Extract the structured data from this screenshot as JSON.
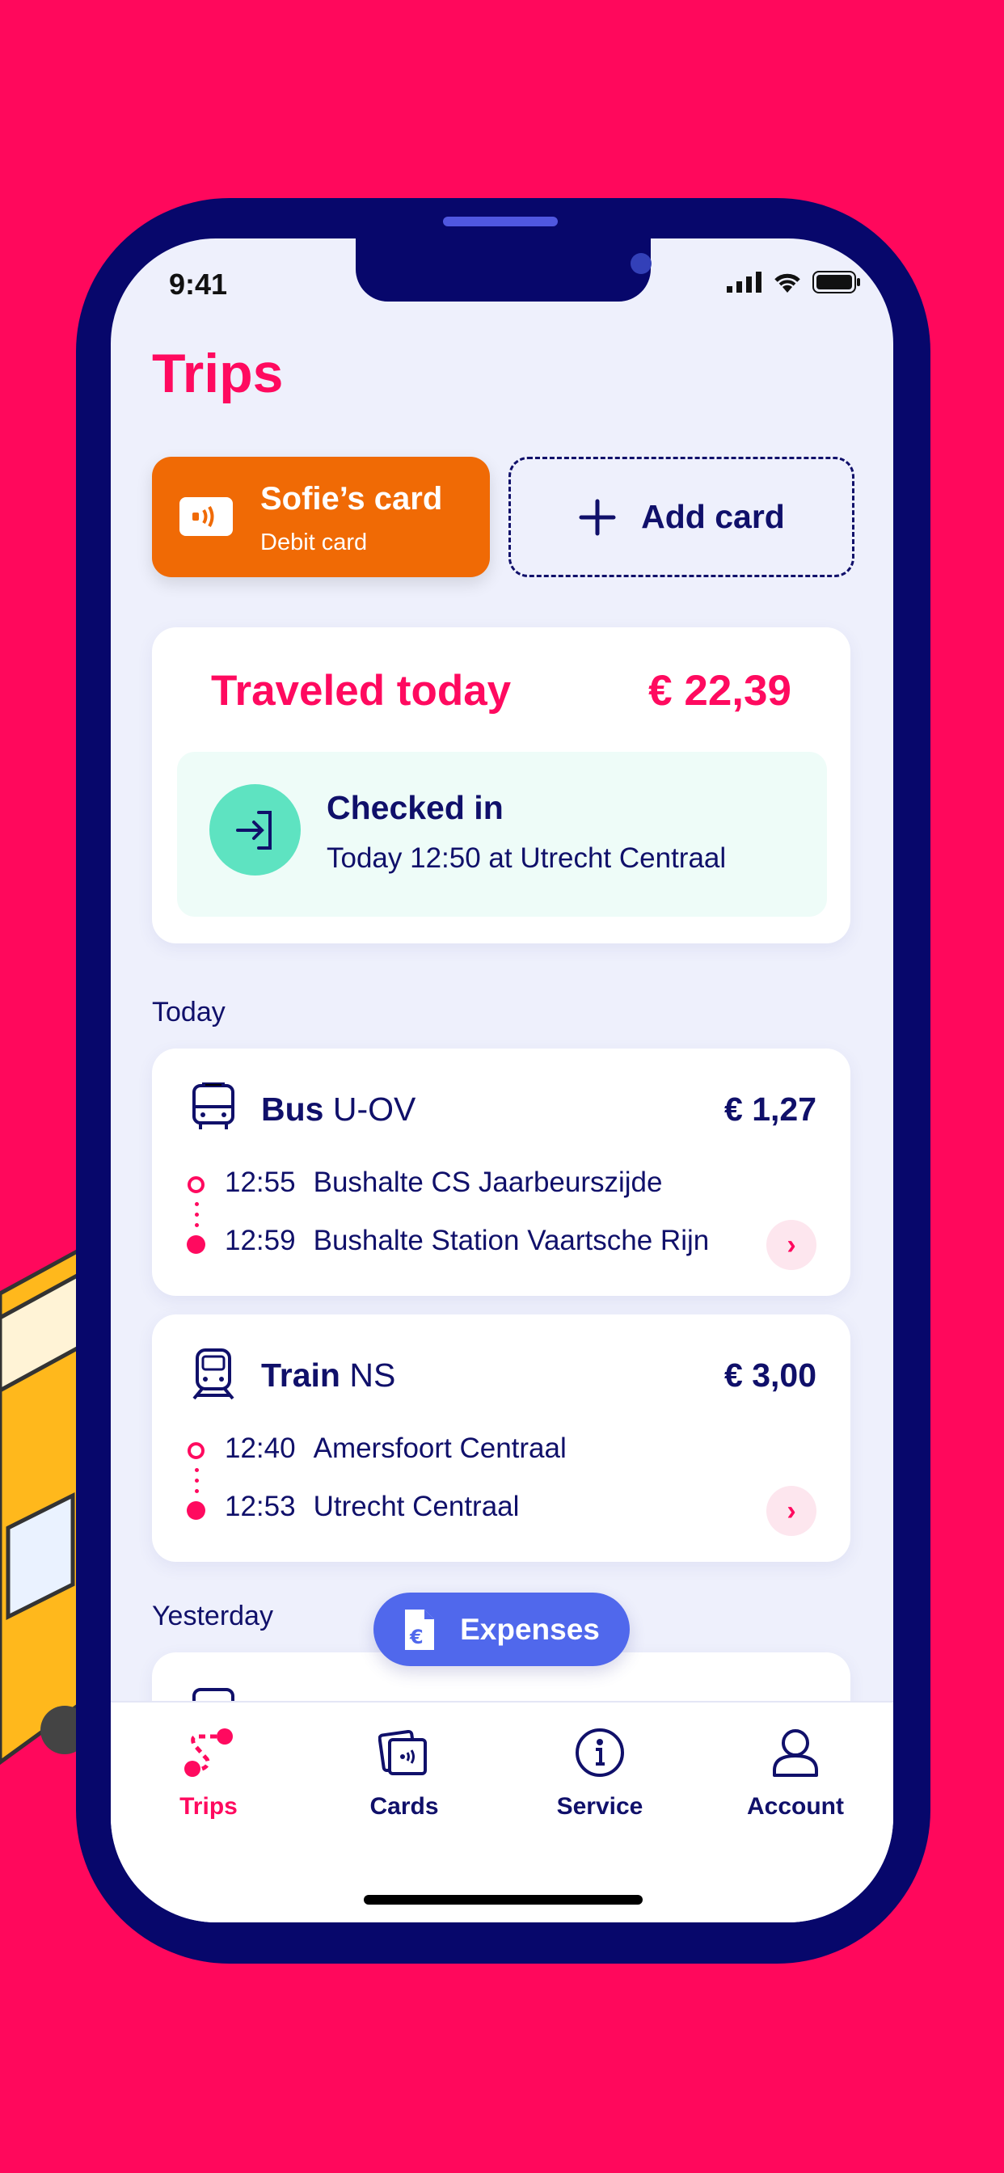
{
  "status_bar": {
    "time": "9:41"
  },
  "header": {
    "title": "Trips"
  },
  "cards": {
    "selected": {
      "name": "Sofie’s card",
      "type": "Debit card",
      "color": "#f06a05"
    },
    "add_label": "Add card"
  },
  "summary": {
    "label": "Traveled today",
    "amount": "€ 22,39",
    "checkin": {
      "title": "Checked in",
      "detail": "Today 12:50 at Utrecht Centraal"
    }
  },
  "sections": {
    "today": "Today",
    "yesterday": "Yesterday"
  },
  "trips": [
    {
      "mode": "Bus",
      "operator": "U-OV",
      "price": "€ 1,27",
      "icon": "bus-icon",
      "from_time": "12:55",
      "from": "Bushalte CS Jaarbeurszijde",
      "to_time": "12:59",
      "to": "Bushalte Station Vaartsche Rijn"
    },
    {
      "mode": "Train",
      "operator": "NS",
      "price": "€ 3,00",
      "icon": "train-icon",
      "from_time": "12:40",
      "from": "Amersfoort Centraal",
      "to_time": "12:53",
      "to": "Utrecht Centraal"
    }
  ],
  "expenses_label": "Expenses",
  "tabs": [
    {
      "label": "Trips",
      "active": true
    },
    {
      "label": "Cards"
    },
    {
      "label": "Service"
    },
    {
      "label": "Account"
    }
  ],
  "colors": {
    "background": "#ff085c",
    "accent": "#ff0a5f",
    "navy": "#10106a",
    "expenses": "#5068ec",
    "checkin": "#5ee3c1"
  }
}
